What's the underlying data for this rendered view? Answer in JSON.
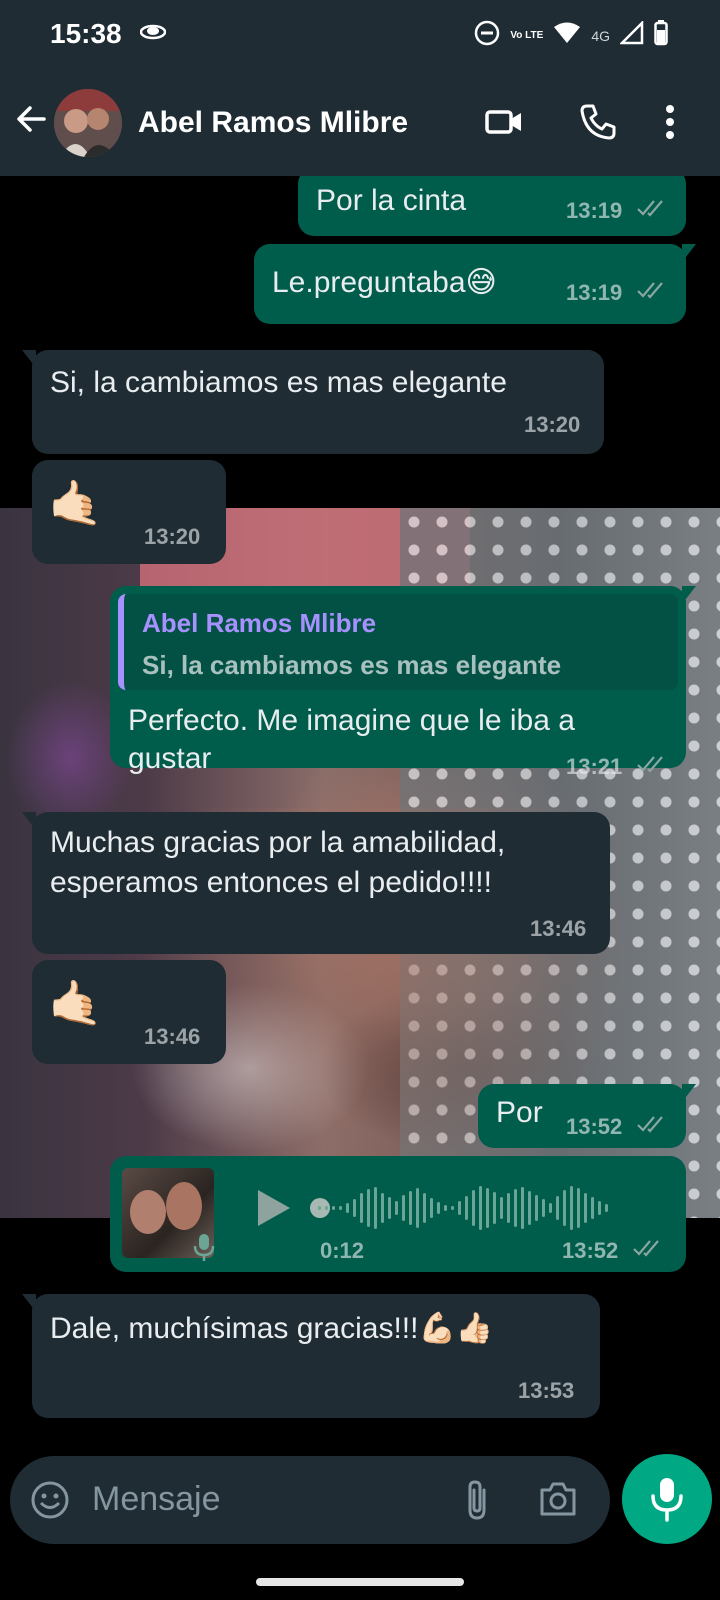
{
  "status_bar": {
    "time": "15:38",
    "network": "4G",
    "volte": "Vo LTE",
    "icons": [
      "eye-icon",
      "dnd-icon",
      "volte-icon",
      "wifi-icon",
      "signal-icon",
      "battery-icon"
    ]
  },
  "header": {
    "contact_name": "Abel Ramos Mlibre",
    "icons": [
      "back-arrow-icon",
      "video-call-icon",
      "phone-call-icon",
      "more-vert-icon"
    ]
  },
  "messages": [
    {
      "dir": "out",
      "text": "Por la cinta",
      "time": "13:19",
      "status": "read"
    },
    {
      "dir": "out",
      "text": "Le.preguntaba😅",
      "time": "13:19",
      "status": "read"
    },
    {
      "dir": "in",
      "text": "Si, la cambiamos es mas elegante",
      "time": "13:20"
    },
    {
      "dir": "in",
      "text": "🤙🏻",
      "time": "13:20"
    },
    {
      "dir": "out",
      "quote": {
        "author": "Abel Ramos Mlibre",
        "text": "Si, la cambiamos es mas elegante"
      },
      "text_lines": [
        "Perfecto. Me imagine que le iba a",
        "gustar"
      ],
      "time": "13:21",
      "status": "read"
    },
    {
      "dir": "in",
      "text_lines": [
        "Muchas gracias por la amabilidad,",
        "esperamos entonces el pedido!!!!"
      ],
      "time": "13:46"
    },
    {
      "dir": "in",
      "text": "🤙🏻",
      "time": "13:46"
    },
    {
      "dir": "out",
      "text": "Por",
      "time": "13:52",
      "status": "read"
    },
    {
      "dir": "out",
      "type": "voice",
      "duration": "0:12",
      "time": "13:52",
      "status": "read"
    },
    {
      "dir": "in",
      "text": "Dale, muchísimas gracias!!!💪🏻👍🏻",
      "time": "13:53"
    }
  ],
  "composer": {
    "placeholder": "Mensaje",
    "icons": [
      "emoji-icon",
      "attach-icon",
      "camera-icon",
      "mic-icon"
    ]
  },
  "colors": {
    "bar": "#1f2c34",
    "incoming": "#1f2c34",
    "outgoing": "#005c4b",
    "accent": "#00a884",
    "quote_author": "#a791ff",
    "read_ticks": "#8aa6a0"
  }
}
